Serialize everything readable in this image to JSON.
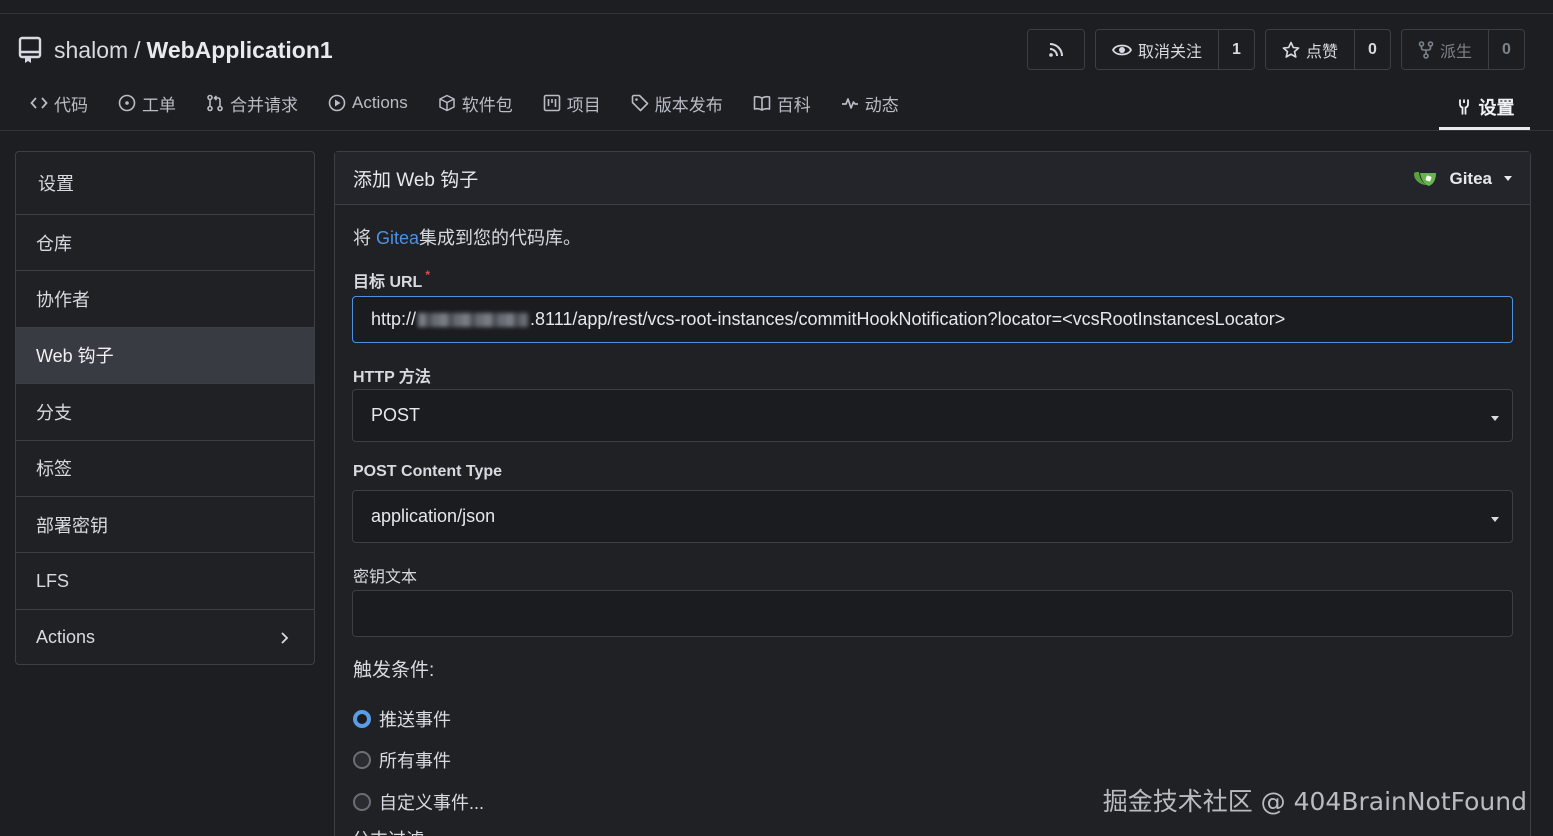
{
  "repo": {
    "owner": "shalom",
    "separator": "/",
    "name": "WebApplication1"
  },
  "repo_actions": [
    {
      "label": "",
      "icon": "rss-icon",
      "count": ""
    },
    {
      "label": "取消关注",
      "icon": "eye-icon",
      "count": "1"
    },
    {
      "label": "点赞",
      "icon": "star-icon",
      "count": "0"
    },
    {
      "label": "派生",
      "icon": "fork-icon",
      "count": "0"
    }
  ],
  "tabs": [
    {
      "label": "代码",
      "icon": "code-icon"
    },
    {
      "label": "工单",
      "icon": "issue-icon"
    },
    {
      "label": "合并请求",
      "icon": "pull-request-icon"
    },
    {
      "label": "Actions",
      "icon": "play-icon"
    },
    {
      "label": "软件包",
      "icon": "package-icon"
    },
    {
      "label": "项目",
      "icon": "project-icon"
    },
    {
      "label": "版本发布",
      "icon": "tag-icon"
    },
    {
      "label": "百科",
      "icon": "book-icon"
    },
    {
      "label": "动态",
      "icon": "pulse-icon"
    }
  ],
  "settings_tab": {
    "label": "设置",
    "icon": "tools-icon"
  },
  "sidebar": {
    "items": [
      {
        "label": "设置"
      },
      {
        "label": "仓库"
      },
      {
        "label": "协作者"
      },
      {
        "label": "Web 钩子",
        "active": true
      },
      {
        "label": "分支"
      },
      {
        "label": "标签"
      },
      {
        "label": "部署密钥"
      },
      {
        "label": "LFS"
      },
      {
        "label": "Actions",
        "has_submenu": true
      }
    ]
  },
  "panel": {
    "title": "添加 Web 钩子",
    "hook_type": "Gitea",
    "intro_prefix": "将 ",
    "intro_link": "Gitea",
    "intro_suffix": "集成到您的代码库。",
    "target_url_label": "目标 URL",
    "required_mark": "*",
    "target_url_prefix": "http://",
    "target_url_suffix": ".8111/app/rest/vcs-root-instances/commitHookNotification?locator=<vcsRootInstancesLocator>",
    "http_method_label": "HTTP 方法",
    "http_method_value": "POST",
    "content_type_label": "POST Content Type",
    "content_type_value": "application/json",
    "secret_label": "密钥文本",
    "secret_value": "",
    "triggers_label": "触发条件:",
    "trigger_options": [
      {
        "label": "推送事件",
        "checked": true
      },
      {
        "label": "所有事件",
        "checked": false
      },
      {
        "label": "自定义事件...",
        "checked": false
      }
    ],
    "cut_off_text": "分支过滤"
  },
  "watermark": "掘金技术社区 @ 404BrainNotFound",
  "colors": {
    "accent": "#4f91e0",
    "background": "#1c1e22",
    "required": "#db4e4e"
  }
}
